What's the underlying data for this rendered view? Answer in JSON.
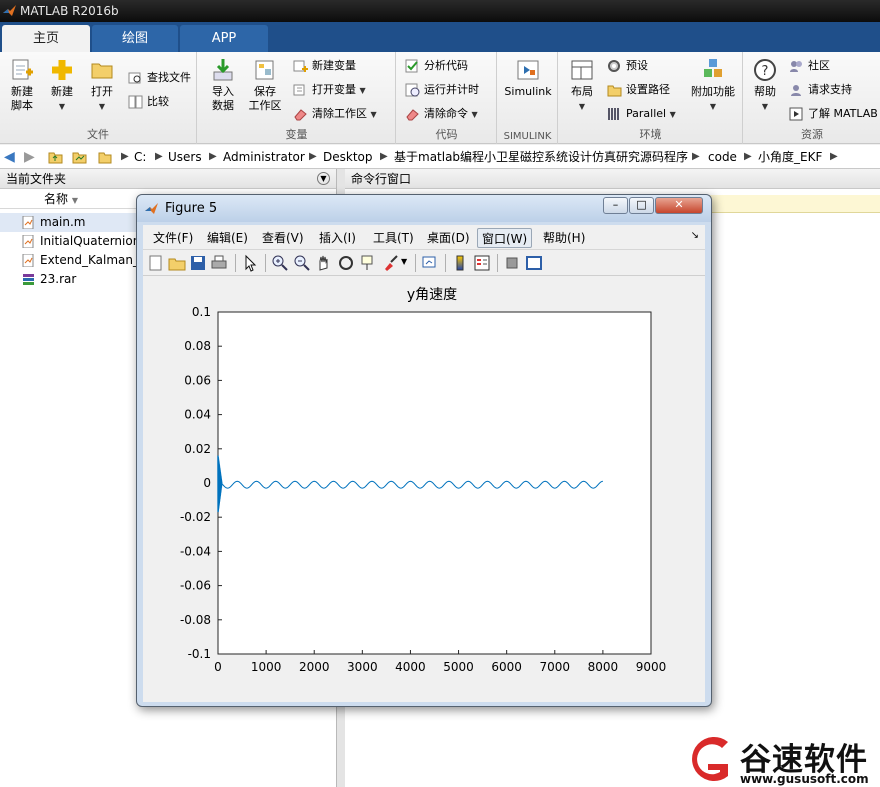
{
  "app": {
    "title": "MATLAB R2016b"
  },
  "tabs": [
    "主页",
    "绘图",
    "APP"
  ],
  "ribbon": {
    "file": {
      "label": "文件",
      "new_script": "新建\n脚本",
      "new": "新建",
      "open": "打开",
      "find_files": "查找文件",
      "compare": "比较"
    },
    "variable": {
      "label": "变量",
      "import": "导入\n数据",
      "save_ws": "保存\n工作区",
      "new_var": "新建变量",
      "open_var": "打开变量",
      "clear_ws": "清除工作区"
    },
    "code": {
      "label": "代码",
      "analyze": "分析代码",
      "run_time": "运行并计时",
      "clear_cmd": "清除命令"
    },
    "simulink": {
      "label": "SIMULINK",
      "simulink": "Simulink"
    },
    "env": {
      "label": "环境",
      "layout": "布局",
      "prefs": "预设",
      "set_path": "设置路径",
      "parallel": "Parallel",
      "addons": "附加功能"
    },
    "resources": {
      "label": "资源",
      "help": "帮助",
      "community": "社区",
      "support": "请求支持",
      "learn": "了解 MATLAB"
    }
  },
  "address": {
    "parts": [
      "C:",
      "Users",
      "Administrator",
      "Desktop",
      "基于matlab编程小卫星磁控系统设计仿真研究源码程序",
      "code",
      "小角度_EKF"
    ]
  },
  "left_pane": {
    "title": "当前文件夹",
    "col_name": "名称",
    "files": [
      {
        "name": "main.m",
        "icon": "m-file-icon"
      },
      {
        "name": "InitialQuaternion",
        "icon": "m-file-icon"
      },
      {
        "name": "Extend_Kalman_F",
        "icon": "m-file-icon"
      },
      {
        "name": "23.rar",
        "icon": "rar-icon"
      }
    ]
  },
  "right_pane": {
    "title": "命令行窗口"
  },
  "figure": {
    "title": "Figure 5",
    "menu": [
      "文件(F)",
      "编辑(E)",
      "查看(V)",
      "插入(I)",
      "工具(T)",
      "桌面(D)",
      "窗口(W)",
      "帮助(H)"
    ],
    "active_menu": "窗口(W)"
  },
  "chart_data": {
    "type": "line",
    "title": "y角速度",
    "xlabel": "",
    "ylabel": "",
    "xlim": [
      0,
      9000
    ],
    "ylim": [
      -0.1,
      0.1
    ],
    "xticks": [
      0,
      1000,
      2000,
      3000,
      4000,
      5000,
      6000,
      7000,
      8000,
      9000
    ],
    "yticks": [
      -0.1,
      -0.08,
      -0.06,
      -0.04,
      -0.02,
      0,
      0.02,
      0.04,
      0.06,
      0.08,
      0.1
    ],
    "ytick_labels": [
      "-0.1",
      "-0.08",
      "-0.06",
      "-0.04",
      "-0.02",
      "0",
      "0.02",
      "0.04",
      "0.06",
      "0.08",
      "0.1"
    ],
    "series": [
      {
        "color": "#0072bd",
        "description_points": {
          "x_start": 0,
          "x_end": 8000,
          "transient_range": [
            -0.017,
            0.016
          ],
          "transient_until": 80,
          "oscillation_amplitude": 0.002,
          "oscillation_center": -0.001,
          "oscillation_period": 400
        }
      }
    ],
    "grid": false
  },
  "watermark": {
    "text": "谷速软件",
    "url": "www.gususoft.com",
    "color": "#d92a2a"
  }
}
